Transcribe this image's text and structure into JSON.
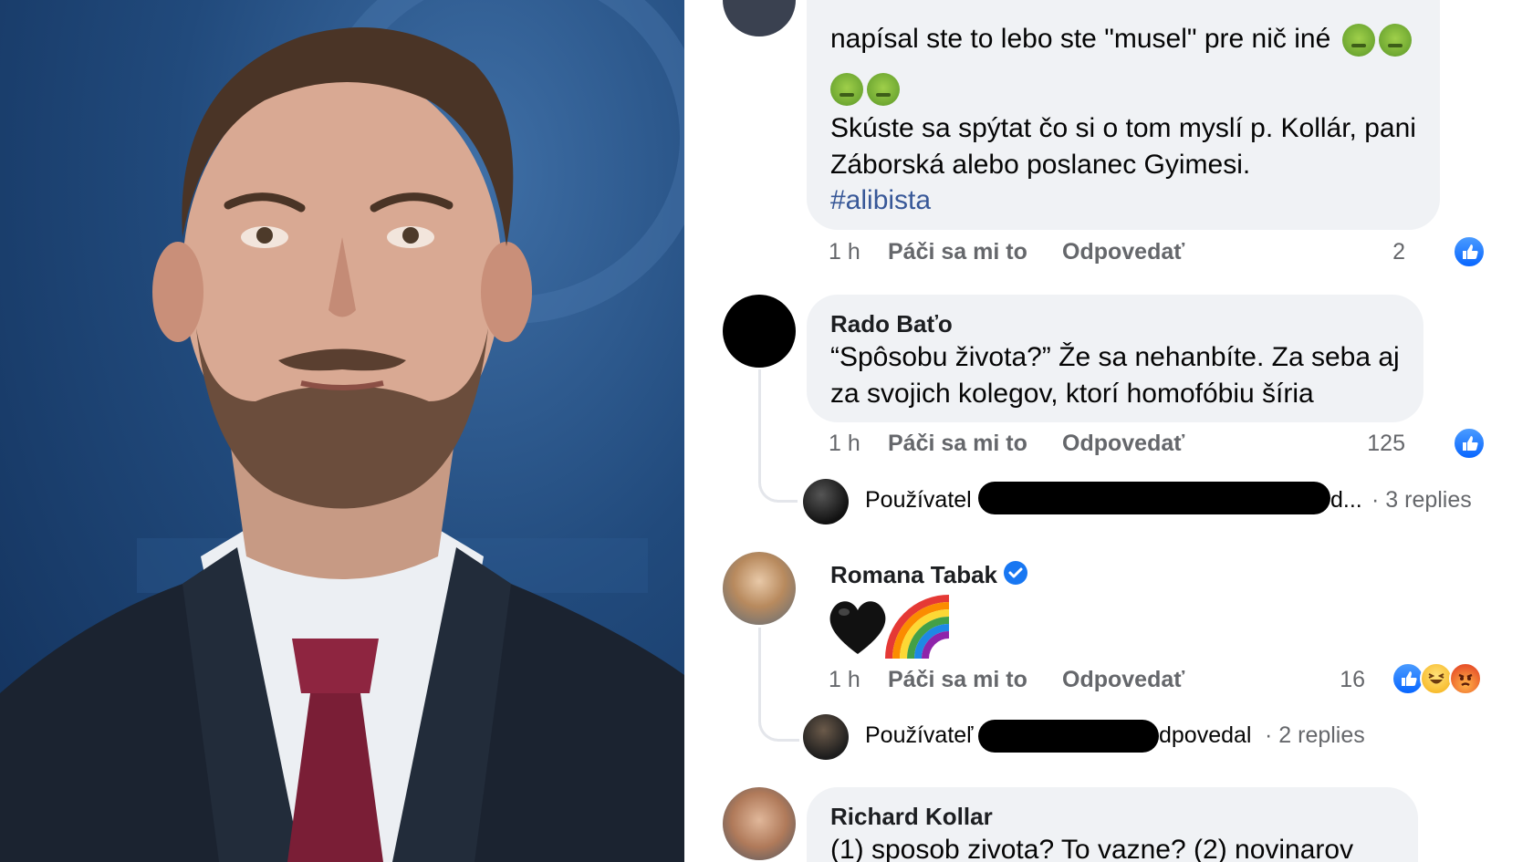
{
  "comments": [
    {
      "text_line1": "napísal ste to lebo ste \"musel\" pre nič iné",
      "text_line2": "Skúste sa spýtat čo si o tom myslí p. Kollár, pani",
      "text_line3": "Záborská alebo poslanec Gyimesi.",
      "hashtag": "#alibista",
      "time": "1 h",
      "like_label": "Páči sa mi to",
      "reply_label": "Odpovedať",
      "reaction_count": "2"
    },
    {
      "author": "Rado Baťo",
      "text_line1": "“Spôsobu života?” Že sa nehanbíte. Za seba aj",
      "text_line2": "za svojich kolegov, ktorí homofóbiu šíria",
      "time": "1 h",
      "like_label": "Páči sa mi to",
      "reply_label": "Odpovedať",
      "reaction_count": "125",
      "reply_preview": {
        "prefix": "Používatel",
        "suffix": "d...",
        "replies": "· 3 replies"
      }
    },
    {
      "author": "Romana Tabak",
      "verified": true,
      "time": "1 h",
      "like_label": "Páči sa mi to",
      "reply_label": "Odpovedať",
      "reaction_count": "16",
      "reply_preview": {
        "prefix": "Používateľ",
        "suffix": "dpovedal",
        "replies": "· 2 replies"
      }
    },
    {
      "author": "Richard Kollar",
      "text_line1": "(1) sposob zivota? To vazne? (2) novinarov"
    }
  ],
  "colors": {
    "bubble": "#f0f2f5",
    "like_blue": "#0866ff",
    "meta_gray": "#65676b",
    "hashtag": "#385898"
  },
  "icons": [
    "like-icon",
    "haha-icon",
    "angry-icon",
    "verified-badge-icon",
    "black-heart-icon",
    "rainbow-icon",
    "nauseated-face-icon"
  ]
}
